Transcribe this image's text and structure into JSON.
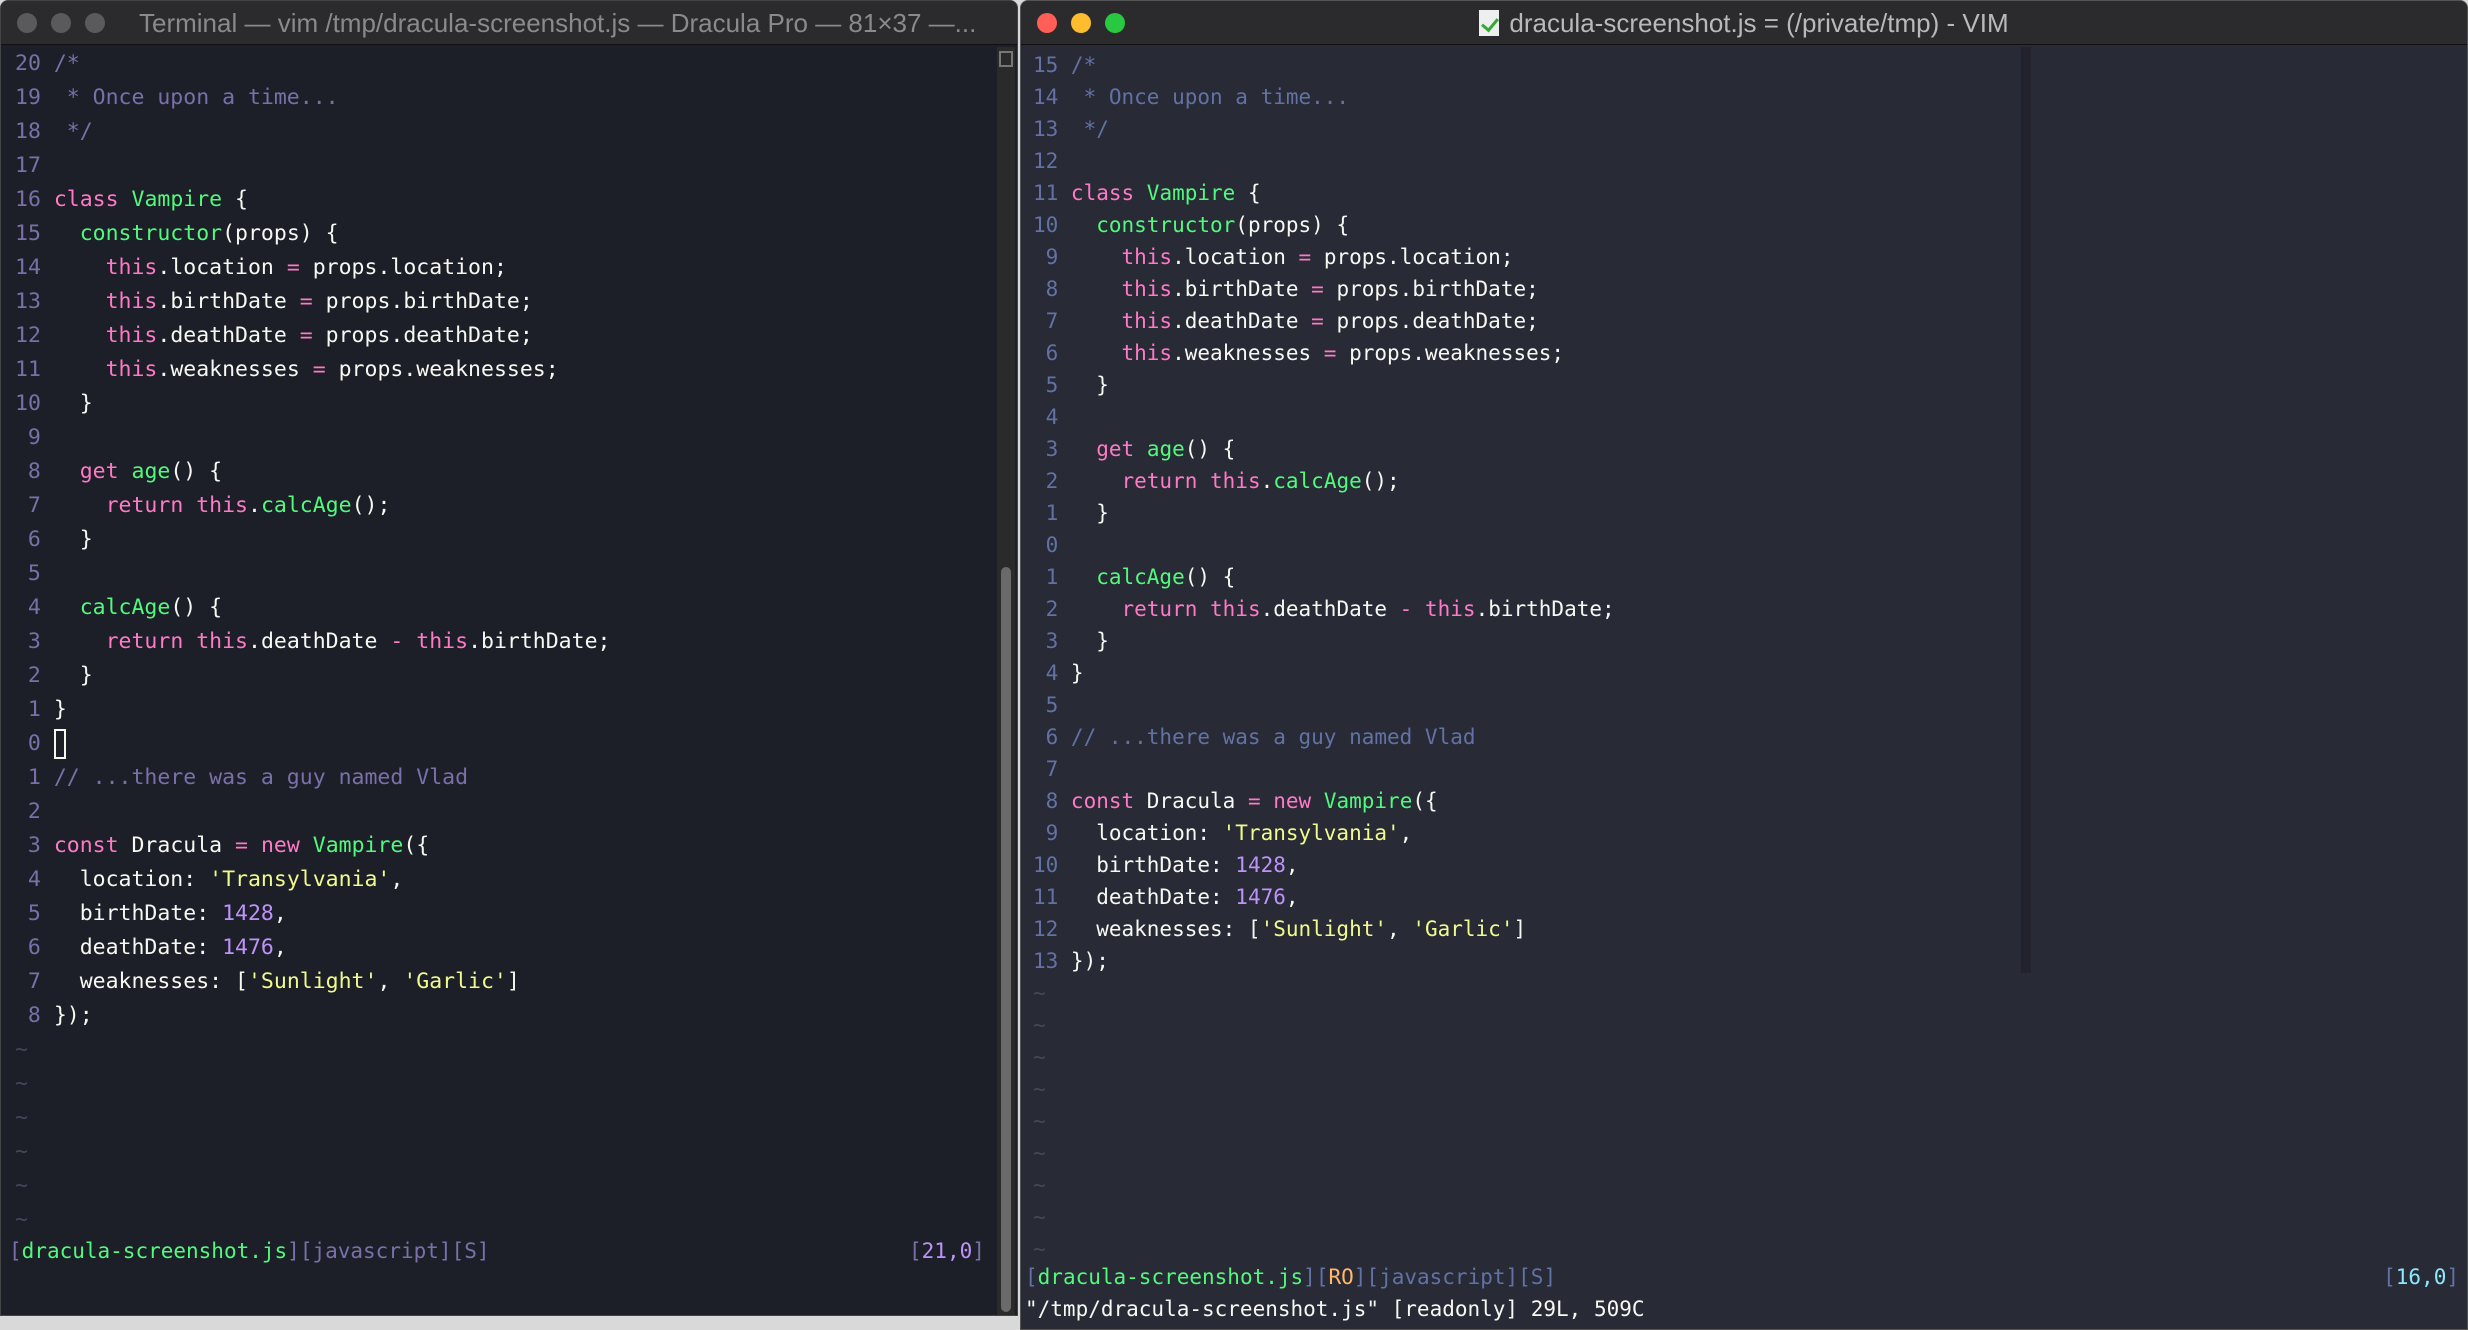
{
  "left": {
    "title": "Terminal — vim /tmp/dracula-screenshot.js — Dracula Pro — 81×37 —...",
    "lights": [
      "#5a5a5c",
      "#5a5a5c",
      "#5a5a5c"
    ],
    "lines": [
      [
        "20",
        [
          [
            "c",
            "/*"
          ]
        ]
      ],
      [
        "19",
        [
          [
            "c",
            " * Once upon a time..."
          ]
        ]
      ],
      [
        "18",
        [
          [
            "c",
            " */"
          ]
        ]
      ],
      [
        "17",
        []
      ],
      [
        "16",
        [
          [
            "k",
            "class"
          ],
          [
            "p",
            " "
          ],
          [
            "f",
            "Vampire"
          ],
          [
            "p",
            " {"
          ]
        ]
      ],
      [
        "15",
        [
          [
            "p",
            "  "
          ],
          [
            "f",
            "constructor"
          ],
          [
            "p",
            "(props) {"
          ]
        ]
      ],
      [
        "14",
        [
          [
            "p",
            "    "
          ],
          [
            "k",
            "this"
          ],
          [
            "p",
            ".location "
          ],
          [
            "o",
            "="
          ],
          [
            "p",
            " props.location;"
          ]
        ]
      ],
      [
        "13",
        [
          [
            "p",
            "    "
          ],
          [
            "k",
            "this"
          ],
          [
            "p",
            ".birthDate "
          ],
          [
            "o",
            "="
          ],
          [
            "p",
            " props.birthDate;"
          ]
        ]
      ],
      [
        "12",
        [
          [
            "p",
            "    "
          ],
          [
            "k",
            "this"
          ],
          [
            "p",
            ".deathDate "
          ],
          [
            "o",
            "="
          ],
          [
            "p",
            " props.deathDate;"
          ]
        ]
      ],
      [
        "11",
        [
          [
            "p",
            "    "
          ],
          [
            "k",
            "this"
          ],
          [
            "p",
            ".weaknesses "
          ],
          [
            "o",
            "="
          ],
          [
            "p",
            " props.weaknesses;"
          ]
        ]
      ],
      [
        "10",
        [
          [
            "p",
            "  }"
          ]
        ]
      ],
      [
        "9",
        []
      ],
      [
        "8",
        [
          [
            "p",
            "  "
          ],
          [
            "k",
            "get"
          ],
          [
            "p",
            " "
          ],
          [
            "f",
            "age"
          ],
          [
            "p",
            "() {"
          ]
        ]
      ],
      [
        "7",
        [
          [
            "p",
            "    "
          ],
          [
            "k",
            "return"
          ],
          [
            "p",
            " "
          ],
          [
            "k",
            "this"
          ],
          [
            "p",
            "."
          ],
          [
            "f",
            "calcAge"
          ],
          [
            "p",
            "();"
          ]
        ]
      ],
      [
        "6",
        [
          [
            "p",
            "  }"
          ]
        ]
      ],
      [
        "5",
        []
      ],
      [
        "4",
        [
          [
            "p",
            "  "
          ],
          [
            "f",
            "calcAge"
          ],
          [
            "p",
            "() {"
          ]
        ]
      ],
      [
        "3",
        [
          [
            "p",
            "    "
          ],
          [
            "k",
            "return"
          ],
          [
            "p",
            " "
          ],
          [
            "k",
            "this"
          ],
          [
            "p",
            ".deathDate "
          ],
          [
            "o",
            "-"
          ],
          [
            "p",
            " "
          ],
          [
            "k",
            "this"
          ],
          [
            "p",
            ".birthDate;"
          ]
        ]
      ],
      [
        "2",
        [
          [
            "p",
            "  }"
          ]
        ]
      ],
      [
        "1",
        [
          [
            "p",
            "}"
          ]
        ]
      ],
      [
        "0",
        [
          [
            "cursor",
            ""
          ]
        ]
      ],
      [
        "1",
        [
          [
            "c",
            "// ...there was a guy named Vlad"
          ]
        ]
      ],
      [
        "2",
        []
      ],
      [
        "3",
        [
          [
            "k",
            "const"
          ],
          [
            "p",
            " Dracula "
          ],
          [
            "o",
            "="
          ],
          [
            "p",
            " "
          ],
          [
            "k",
            "new"
          ],
          [
            "p",
            " "
          ],
          [
            "f",
            "Vampire"
          ],
          [
            "p",
            "({"
          ]
        ]
      ],
      [
        "4",
        [
          [
            "p",
            "  location: "
          ],
          [
            "s",
            "'Transylvania'"
          ],
          [
            "p",
            ","
          ]
        ]
      ],
      [
        "5",
        [
          [
            "p",
            "  birthDate: "
          ],
          [
            "n",
            "1428"
          ],
          [
            "p",
            ","
          ]
        ]
      ],
      [
        "6",
        [
          [
            "p",
            "  deathDate: "
          ],
          [
            "n",
            "1476"
          ],
          [
            "p",
            ","
          ]
        ]
      ],
      [
        "7",
        [
          [
            "p",
            "  weaknesses: ["
          ],
          [
            "s",
            "'Sunlight'"
          ],
          [
            "p",
            ", "
          ],
          [
            "s",
            "'Garlic'"
          ],
          [
            "p",
            "]"
          ]
        ]
      ],
      [
        "8",
        [
          [
            "p",
            "});"
          ]
        ]
      ]
    ],
    "tildes": 6,
    "status": {
      "file": "dracula-screenshot.js",
      "lang": "javascript",
      "flag": "S",
      "pos": "21,0"
    }
  },
  "right": {
    "title": "dracula-screenshot.js = (/private/tmp) - VIM",
    "lights": [
      "#ff5f57",
      "#febc2e",
      "#28c840"
    ],
    "lines": [
      [
        "15",
        [
          [
            "c",
            "/*"
          ]
        ]
      ],
      [
        "14",
        [
          [
            "c",
            " * Once upon a time..."
          ]
        ]
      ],
      [
        "13",
        [
          [
            "c",
            " */"
          ]
        ]
      ],
      [
        "12",
        []
      ],
      [
        "11",
        [
          [
            "k",
            "class"
          ],
          [
            "p",
            " "
          ],
          [
            "f",
            "Vampire"
          ],
          [
            "p",
            " {"
          ]
        ]
      ],
      [
        "10",
        [
          [
            "p",
            "  "
          ],
          [
            "f",
            "constructor"
          ],
          [
            "p",
            "(props) {"
          ]
        ]
      ],
      [
        "9",
        [
          [
            "p",
            "    "
          ],
          [
            "k",
            "this"
          ],
          [
            "p",
            ".location "
          ],
          [
            "o",
            "="
          ],
          [
            "p",
            " props.location;"
          ]
        ]
      ],
      [
        "8",
        [
          [
            "p",
            "    "
          ],
          [
            "k",
            "this"
          ],
          [
            "p",
            ".birthDate "
          ],
          [
            "o",
            "="
          ],
          [
            "p",
            " props.birthDate;"
          ]
        ]
      ],
      [
        "7",
        [
          [
            "p",
            "    "
          ],
          [
            "k",
            "this"
          ],
          [
            "p",
            ".deathDate "
          ],
          [
            "o",
            "="
          ],
          [
            "p",
            " props.deathDate;"
          ]
        ]
      ],
      [
        "6",
        [
          [
            "p",
            "    "
          ],
          [
            "k",
            "this"
          ],
          [
            "p",
            ".weaknesses "
          ],
          [
            "o",
            "="
          ],
          [
            "p",
            " props.weaknesses;"
          ]
        ]
      ],
      [
        "5",
        [
          [
            "p",
            "  }"
          ]
        ]
      ],
      [
        "4",
        []
      ],
      [
        "3",
        [
          [
            "p",
            "  "
          ],
          [
            "k",
            "get"
          ],
          [
            "p",
            " "
          ],
          [
            "f",
            "age"
          ],
          [
            "p",
            "() {"
          ]
        ]
      ],
      [
        "2",
        [
          [
            "p",
            "    "
          ],
          [
            "k",
            "return"
          ],
          [
            "p",
            " "
          ],
          [
            "k",
            "this"
          ],
          [
            "p",
            "."
          ],
          [
            "f",
            "calcAge"
          ],
          [
            "p",
            "();"
          ]
        ]
      ],
      [
        "1",
        [
          [
            "p",
            "  }"
          ]
        ]
      ],
      [
        "0",
        []
      ],
      [
        "1",
        [
          [
            "p",
            "  "
          ],
          [
            "f",
            "calcAge"
          ],
          [
            "p",
            "() {"
          ]
        ]
      ],
      [
        "2",
        [
          [
            "p",
            "    "
          ],
          [
            "k",
            "return"
          ],
          [
            "p",
            " "
          ],
          [
            "k",
            "this"
          ],
          [
            "p",
            ".deathDate "
          ],
          [
            "o",
            "-"
          ],
          [
            "p",
            " "
          ],
          [
            "k",
            "this"
          ],
          [
            "p",
            ".birthDate;"
          ]
        ]
      ],
      [
        "3",
        [
          [
            "p",
            "  }"
          ]
        ]
      ],
      [
        "4",
        [
          [
            "p",
            "}"
          ]
        ]
      ],
      [
        "5",
        []
      ],
      [
        "6",
        [
          [
            "c",
            "// ...there was a guy named Vlad"
          ]
        ]
      ],
      [
        "7",
        []
      ],
      [
        "8",
        [
          [
            "k",
            "const"
          ],
          [
            "p",
            " Dracula "
          ],
          [
            "o",
            "="
          ],
          [
            "p",
            " "
          ],
          [
            "k",
            "new"
          ],
          [
            "p",
            " "
          ],
          [
            "f",
            "Vampire"
          ],
          [
            "p",
            "({"
          ]
        ]
      ],
      [
        "9",
        [
          [
            "p",
            "  location: "
          ],
          [
            "s",
            "'Transylvania'"
          ],
          [
            "p",
            ","
          ]
        ]
      ],
      [
        "10",
        [
          [
            "p",
            "  birthDate: "
          ],
          [
            "n",
            "1428"
          ],
          [
            "p",
            ","
          ]
        ]
      ],
      [
        "11",
        [
          [
            "p",
            "  deathDate: "
          ],
          [
            "n",
            "1476"
          ],
          [
            "p",
            ","
          ]
        ]
      ],
      [
        "12",
        [
          [
            "p",
            "  weaknesses: ["
          ],
          [
            "s",
            "'Sunlight'"
          ],
          [
            "p",
            ", "
          ],
          [
            "s",
            "'Garlic'"
          ],
          [
            "p",
            "]"
          ]
        ]
      ],
      [
        "13",
        [
          [
            "p",
            "});"
          ]
        ]
      ]
    ],
    "tildes": 9,
    "status": {
      "file": "dracula-screenshot.js",
      "ro": "RO",
      "lang": "javascript",
      "flag": "S",
      "pos": "16,0"
    },
    "cmdline": "\"/tmp/dracula-screenshot.js\" [readonly] 29L, 509C"
  },
  "colors": {
    "pink": "#ff79c6",
    "green": "#50fa7b",
    "purple": "#bd93f9",
    "yellow": "#f1fa8c",
    "comment": "#6272a4",
    "orange": "#ffb86c",
    "cyan": "#8be9fd"
  }
}
